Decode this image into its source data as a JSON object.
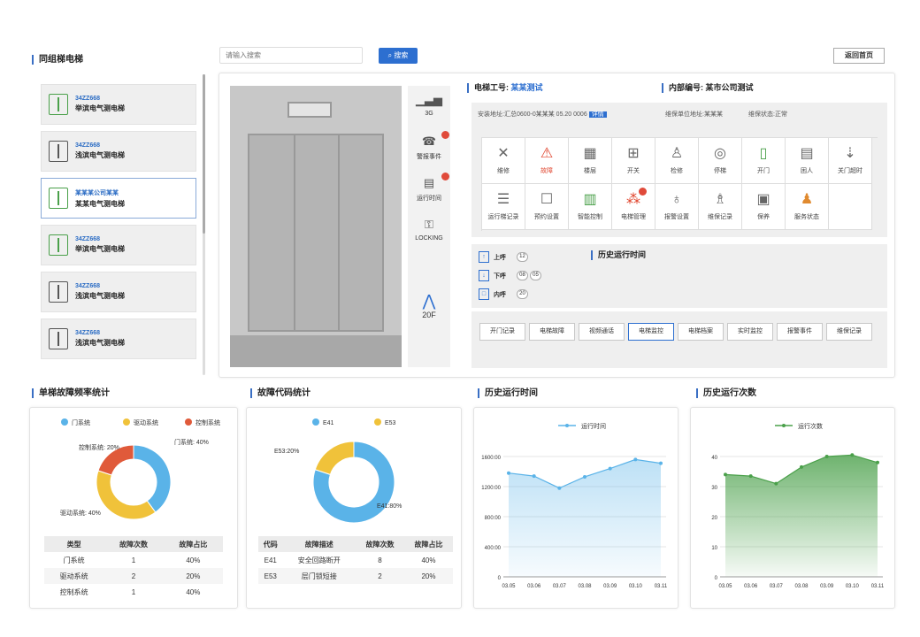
{
  "left_title": "同组梯电梯",
  "search": {
    "placeholder": "请输入搜索",
    "button": "搜索"
  },
  "top_right_btn": "返回首页",
  "elevators": [
    {
      "code": "34ZZ668",
      "name": "举滨电气测电梯",
      "green": true
    },
    {
      "code": "34ZZ668",
      "name": "浅滨电气测电梯",
      "green": false
    },
    {
      "code": "某某某公司某某",
      "name": "某某电气测电梯",
      "green": true
    },
    {
      "code": "34ZZ668",
      "name": "举滨电气测电梯",
      "green": true
    },
    {
      "code": "34ZZ668",
      "name": "浅滨电气测电梯",
      "green": false
    },
    {
      "code": "34ZZ668",
      "name": "浅滨电气测电梯",
      "green": false
    }
  ],
  "side_status": [
    {
      "label": "3G",
      "icon": "signal-icon"
    },
    {
      "label": "警报事件",
      "icon": "alarm-icon"
    },
    {
      "label": "运行时间",
      "icon": "counter-icon"
    },
    {
      "label": "LOCKING",
      "icon": "lock-icon"
    }
  ],
  "floor": "20F",
  "info": {
    "k1": "电梯工号:",
    "v1": "某某测试",
    "k2": "内部编号:",
    "v2": "某市公司测试",
    "row": "安装地址:汇总0600-0某某某 05.20 0006",
    "tag": "详情",
    "row2": "维保单位地址:某某某",
    "row3": "维保状态:正常"
  },
  "funcs": [
    {
      "label": "维修",
      "icon": "tools-icon",
      "color": "#666"
    },
    {
      "label": "故障",
      "icon": "warning-icon",
      "color": "#e0462f"
    },
    {
      "label": "楼层",
      "icon": "doc-icon",
      "color": "#666"
    },
    {
      "label": "开关",
      "icon": "grid-icon",
      "color": "#666"
    },
    {
      "label": "检修",
      "icon": "person-icon",
      "color": "#666"
    },
    {
      "label": "停梯",
      "icon": "circle-icon",
      "color": "#666"
    },
    {
      "label": "开门",
      "icon": "door-icon",
      "color": "#4aa04a"
    },
    {
      "label": "困人",
      "icon": "panel-icon",
      "color": "#666"
    },
    {
      "label": "关门超时",
      "icon": "arrow-icon",
      "color": "#666"
    },
    {
      "label": "运行梯记录",
      "icon": "list-icon",
      "color": "#666"
    },
    {
      "label": "预约设置",
      "icon": "phone-icon",
      "color": "#666"
    },
    {
      "label": "智能控制",
      "icon": "chart-icon",
      "color": "#4aa04a"
    },
    {
      "label": "电梯管理",
      "icon": "apps-icon",
      "color": "#e0462f"
    },
    {
      "label": "报警设置",
      "icon": "bell-icon",
      "color": "#666"
    },
    {
      "label": "维保记录",
      "icon": "person2-icon",
      "color": "#666"
    },
    {
      "label": "保养",
      "icon": "book-icon",
      "color": "#666"
    },
    {
      "label": "服务状态",
      "icon": "user-icon",
      "color": "#e08a2f"
    }
  ],
  "directions": [
    {
      "label": "上呼",
      "chips": [
        "12"
      ]
    },
    {
      "label": "下呼",
      "chips": [
        "08",
        "05"
      ]
    },
    {
      "label": "内呼",
      "chips": [
        "20"
      ]
    }
  ],
  "hist_title_mid": "历史运行时间",
  "actions": [
    "开门记录",
    "电梯故障",
    "视频通话",
    "电梯监控",
    "电梯档案",
    "实时监控",
    "报警事件",
    "维保记录"
  ],
  "sections": {
    "s1": "单梯故障频率统计",
    "s2": "故障代码统计",
    "s3": "历史运行时间",
    "s4": "历史运行次数"
  },
  "pie1": {
    "legend": [
      "门系统",
      "驱动系统",
      "控制系统"
    ],
    "colors": [
      "#5ab3e8",
      "#f0c23a",
      "#e05a3a"
    ],
    "values": [
      40,
      40,
      20
    ],
    "labels": [
      "门系统: 40%",
      "驱动系统: 40%",
      "控制系统: 20%"
    ],
    "table": {
      "head": [
        "类型",
        "故障次数",
        "故障占比"
      ],
      "rows": [
        [
          "门系统",
          "1",
          "40%"
        ],
        [
          "驱动系统",
          "2",
          "20%"
        ],
        [
          "控制系统",
          "1",
          "40%"
        ]
      ]
    }
  },
  "pie2": {
    "legend": [
      "E41",
      "E53"
    ],
    "colors": [
      "#5ab3e8",
      "#f0c23a"
    ],
    "values": [
      80,
      20
    ],
    "labels": [
      "E41:80%",
      "E53:20%"
    ],
    "table": {
      "head": [
        "代码",
        "故障描述",
        "故障次数",
        "故障占比"
      ],
      "rows": [
        [
          "E41",
          "安全回路断开",
          "8",
          "40%"
        ],
        [
          "E53",
          "层门锁短接",
          "2",
          "20%"
        ]
      ]
    }
  },
  "chart_data": [
    {
      "type": "area",
      "legend": "运行时间",
      "color": "#5ab3e8",
      "x": [
        "03.05",
        "03.06",
        "03.07",
        "03.08",
        "03.09",
        "03.10",
        "03.11"
      ],
      "y": [
        1380,
        1340,
        1180,
        1330,
        1440,
        1560,
        1510
      ],
      "yticks": [
        "0",
        "400:00",
        "800:00",
        "1200:00",
        "1600:00"
      ],
      "ylim": [
        0,
        1800
      ]
    },
    {
      "type": "area",
      "legend": "运行次数",
      "color": "#4aa04a",
      "x": [
        "03.05",
        "03.06",
        "03.07",
        "03.08",
        "03.09",
        "03.10",
        "03.11"
      ],
      "y": [
        34,
        33.5,
        31,
        36.5,
        40,
        40.5,
        38
      ],
      "yticks": [
        "0",
        "10",
        "20",
        "30",
        "40"
      ],
      "ylim": [
        0,
        45
      ]
    }
  ]
}
